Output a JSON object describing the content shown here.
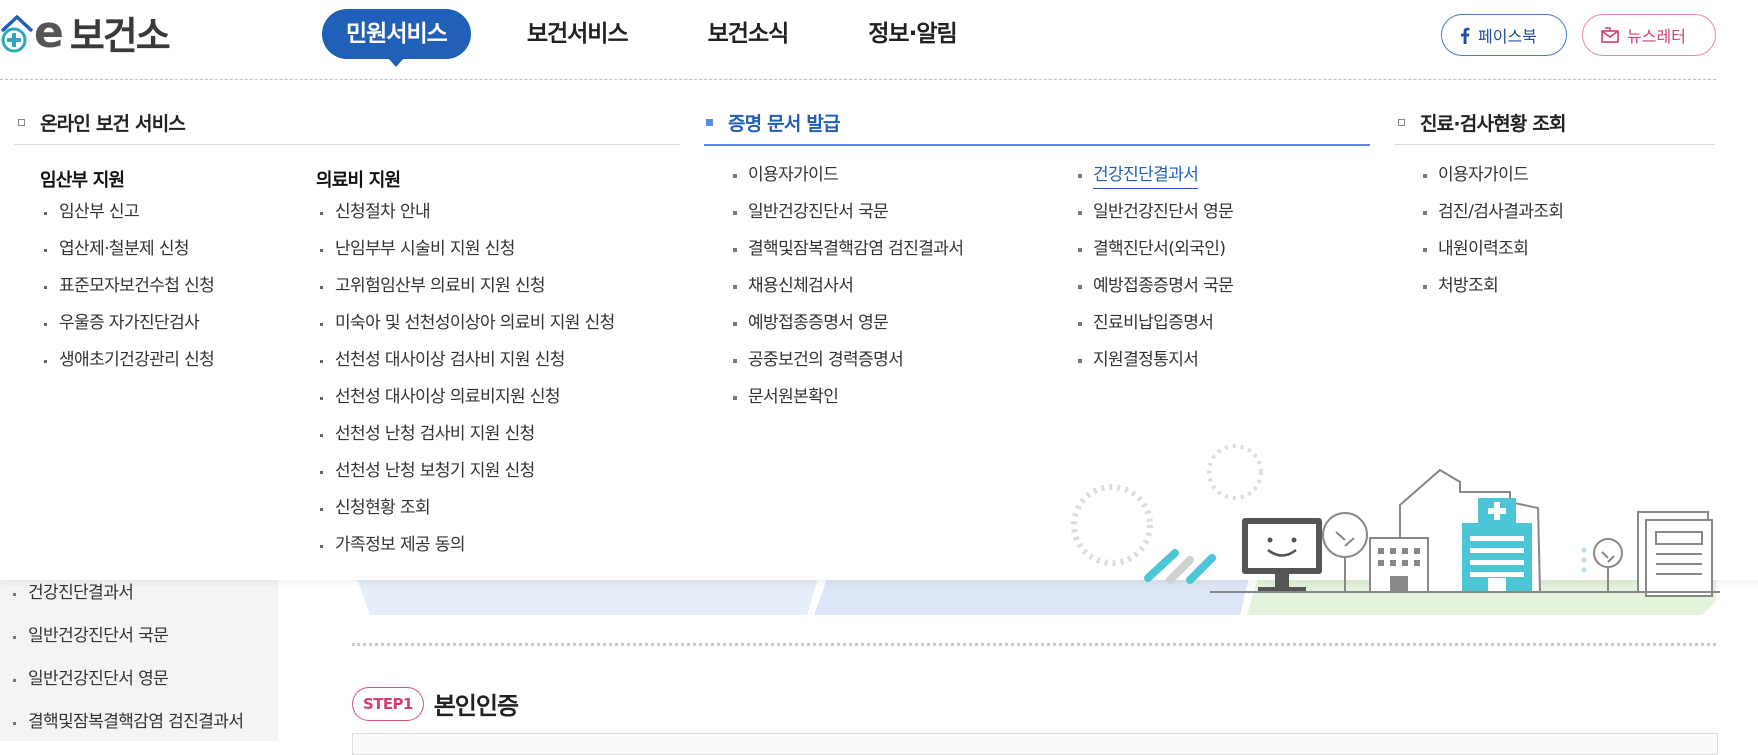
{
  "brand": {
    "name": "e보건소",
    "letter": "e",
    "rest": "보건소"
  },
  "gnb": {
    "items": [
      {
        "label": "민원서비스",
        "active": true
      },
      {
        "label": "보건서비스",
        "active": false
      },
      {
        "label": "보건소식",
        "active": false
      },
      {
        "label": "정보·알림",
        "active": false
      }
    ]
  },
  "sns": {
    "facebook": "페이스북",
    "newsletter": "뉴스레터"
  },
  "mega": {
    "col1": {
      "title": "온라인 보건 서비스",
      "groupA": {
        "title": "임산부 지원",
        "items": [
          "임산부 신고",
          "엽산제·철분제 신청",
          "표준모자보건수첩 신청",
          "우울증 자가진단검사",
          "생애초기건강관리 신청"
        ]
      },
      "groupB": {
        "title": "의료비 지원",
        "items": [
          "신청절차 안내",
          "난임부부 시술비 지원 신청",
          "고위험임산부 의료비 지원 신청",
          "미숙아 및 선천성이상아 의료비 지원 신청",
          "선천성 대사이상 검사비 지원 신청",
          "선천성 대사이상 의료비지원 신청",
          "선천성 난청 검사비 지원 신청",
          "선천성 난청 보청기 지원 신청",
          "신청현황 조회",
          "가족정보 제공 동의"
        ]
      }
    },
    "col2": {
      "title": "증명 문서 발급",
      "left": [
        "이용자가이드",
        "일반건강진단서 국문",
        "결핵및잠복결핵감염 검진결과서",
        "채용신체검사서",
        "예방접종증명서 영문",
        "공중보건의 경력증명서",
        "문서원본확인"
      ],
      "right": [
        "건강진단결과서",
        "일반건강진단서 영문",
        "결핵진단서(외국인)",
        "예방접종증명서 국문",
        "진료비납입증명서",
        "지원결정통지서"
      ]
    },
    "col3": {
      "title": "진료·검사현황 조회",
      "items": [
        "이용자가이드",
        "검진/검사결과조회",
        "내원이력조회",
        "처방조회"
      ]
    }
  },
  "sidebar": {
    "items": [
      "건강진단결과서",
      "일반건강진단서 국문",
      "일반건강진단서 영문",
      "결핵및잠복결핵감염 검진결과서"
    ]
  },
  "step": {
    "badge": "STEP1",
    "title": "본인인증"
  },
  "colors": {
    "primary": "#2160b8",
    "pink": "#d23f70",
    "teal": "#4cc6d6"
  }
}
